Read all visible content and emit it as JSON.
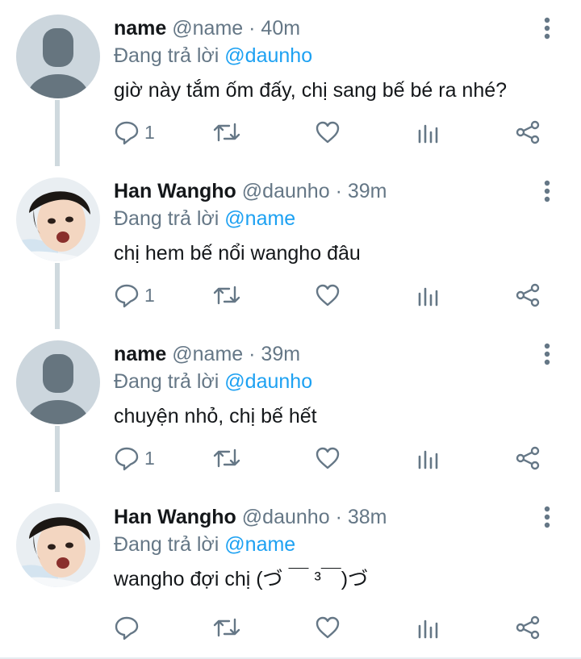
{
  "tweets": [
    {
      "name": "name",
      "handle": "@name",
      "time": "· 40m",
      "reply_prefix": "Đang trả lời",
      "reply_to": "@daunho",
      "text": "giờ này tắm ốm đấy, chị sang bế bé ra nhé?",
      "reply_count": "1",
      "avatar": "default-avatar"
    },
    {
      "name": "Han Wangho",
      "handle": "@daunho",
      "time": "· 39m",
      "reply_prefix": "Đang trả lời",
      "reply_to": "@name",
      "text": "chị hem bế nổi wangho đâu",
      "reply_count": "1",
      "avatar": "photo-avatar"
    },
    {
      "name": "name",
      "handle": "@name",
      "time": "· 39m",
      "reply_prefix": "Đang trả lời",
      "reply_to": "@daunho",
      "text": "chuyện nhỏ, chị bế hết",
      "reply_count": "1",
      "avatar": "default-avatar"
    },
    {
      "name": "Han Wangho",
      "handle": "@daunho",
      "time": "· 38m",
      "reply_prefix": "Đang trả lời",
      "reply_to": "@name",
      "text": "wangho đợi chị (づ ￣ ³￣)づ",
      "reply_count": "",
      "avatar": "photo-avatar"
    }
  ],
  "icons": {
    "reply": "reply-icon",
    "retweet": "retweet-icon",
    "like": "heart-icon",
    "analytics": "analytics-icon",
    "share": "share-icon",
    "menu": "more-vertical-icon"
  },
  "colors": {
    "text": "#14171a",
    "secondary": "#657786",
    "link": "#1da1f2",
    "thread_line": "#cfd9de"
  }
}
